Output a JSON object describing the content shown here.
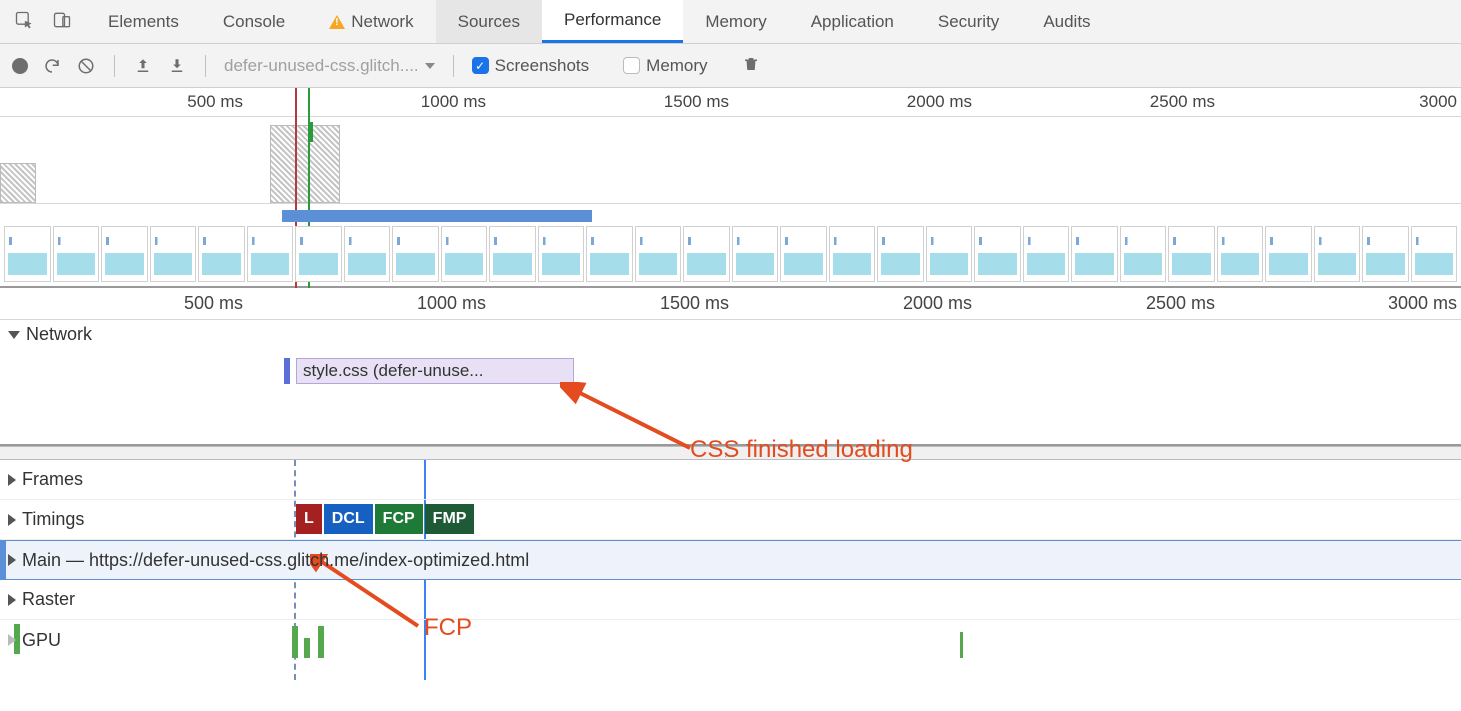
{
  "tabs": {
    "elements": "Elements",
    "console": "Console",
    "network": "Network",
    "sources": "Sources",
    "performance": "Performance",
    "memory": "Memory",
    "application": "Application",
    "security": "Security",
    "audits": "Audits"
  },
  "toolbar": {
    "recording_select": "defer-unused-css.glitch....",
    "screenshots_label": "Screenshots",
    "memory_label": "Memory"
  },
  "overview_ruler": {
    "t1": "500 ms",
    "t2": "1000 ms",
    "t3": "1500 ms",
    "t4": "2000 ms",
    "t5": "2500 ms",
    "t6": "3000"
  },
  "mid_ruler": {
    "t1": "500 ms",
    "t2": "1000 ms",
    "t3": "1500 ms",
    "t4": "2000 ms",
    "t5": "2500 ms",
    "t6": "3000 ms"
  },
  "sections": {
    "network": "Network",
    "frames": "Frames",
    "timings": "Timings",
    "main": "Main — https://defer-unused-css.glitch.me/index-optimized.html",
    "raster": "Raster",
    "gpu": "GPU"
  },
  "network_entry": "style.css (defer-unuse...",
  "timings": {
    "l": "L",
    "dcl": "DCL",
    "fcp": "FCP",
    "fmp": "FMP"
  },
  "annotations": {
    "css_loaded": "CSS finished loading",
    "fcp": "FCP"
  },
  "splitter_dots": "…",
  "colors": {
    "accent_orange": "#e44b1f",
    "badge_l": "#a52020",
    "badge_dcl": "#1560c0",
    "badge_green": "#1f7a37"
  }
}
